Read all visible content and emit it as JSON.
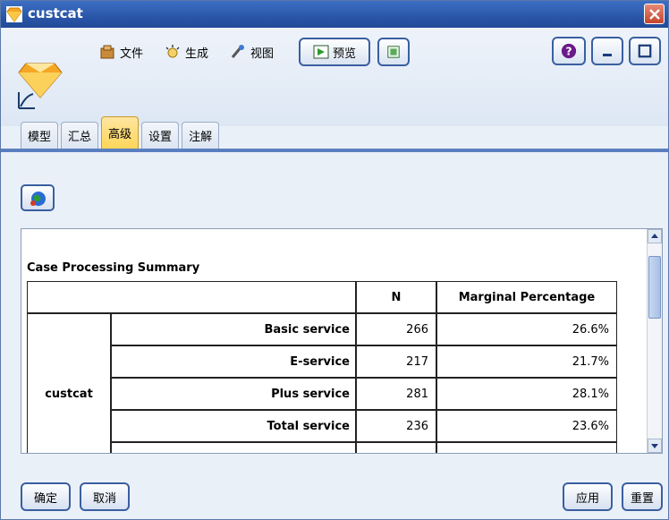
{
  "window": {
    "title": "custcat"
  },
  "menubar": {
    "file": "文件",
    "generate": "生成",
    "view": "视图",
    "preview": "预览"
  },
  "tabs": [
    {
      "label": "模型"
    },
    {
      "label": "汇总"
    },
    {
      "label": "高级"
    },
    {
      "label": "设置"
    },
    {
      "label": "注解"
    }
  ],
  "table": {
    "title": "Case Processing Summary",
    "col_n": "N",
    "col_pct": "Marginal Percentage",
    "group": "custcat",
    "rows": [
      {
        "label": "Basic service",
        "n": "266",
        "pct": "26.6%"
      },
      {
        "label": "E-service",
        "n": "217",
        "pct": "21.7%"
      },
      {
        "label": "Plus service",
        "n": "281",
        "pct": "28.1%"
      },
      {
        "label": "Total service",
        "n": "236",
        "pct": "23.6%"
      }
    ]
  },
  "footer": {
    "ok": "确定",
    "cancel": "取消",
    "apply": "应用",
    "reset": "重置"
  },
  "colors": {
    "titlebar": "#2a56a8",
    "active_tab": "#ffd55a",
    "accent": "#3a5fa0"
  }
}
